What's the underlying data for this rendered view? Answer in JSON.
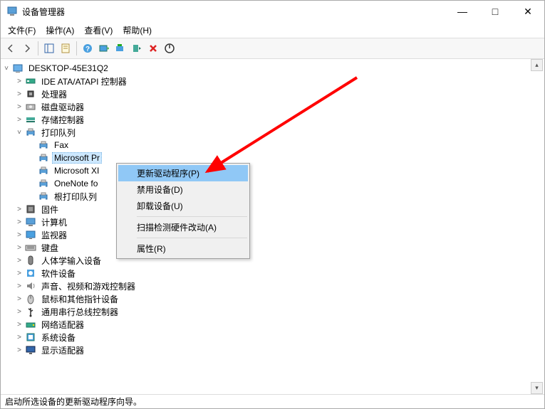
{
  "window": {
    "title": "设备管理器"
  },
  "winControls": {
    "min": "—",
    "max": "□",
    "close": "✕"
  },
  "menu": {
    "file": "文件(F)",
    "action": "操作(A)",
    "view": "查看(V)",
    "help": "帮助(H)"
  },
  "tree": {
    "root": "DESKTOP-45E31Q2",
    "items": [
      {
        "label": "IDE ATA/ATAPI 控制器",
        "icon": "ide",
        "expanded": false
      },
      {
        "label": "处理器",
        "icon": "cpu",
        "expanded": false
      },
      {
        "label": "磁盘驱动器",
        "icon": "disk",
        "expanded": false
      },
      {
        "label": "存储控制器",
        "icon": "storage",
        "expanded": false
      },
      {
        "label": "打印队列",
        "icon": "printer",
        "expanded": true,
        "children": [
          {
            "label": "Fax",
            "icon": "printer"
          },
          {
            "label": "Microsoft Pr",
            "icon": "printer",
            "selected": true
          },
          {
            "label": "Microsoft XI",
            "icon": "printer"
          },
          {
            "label": "OneNote fo",
            "icon": "printer"
          },
          {
            "label": "根打印队列",
            "icon": "printer"
          }
        ]
      },
      {
        "label": "固件",
        "icon": "firmware",
        "expanded": false
      },
      {
        "label": "计算机",
        "icon": "computer",
        "expanded": false
      },
      {
        "label": "监视器",
        "icon": "monitor",
        "expanded": false
      },
      {
        "label": "键盘",
        "icon": "keyboard",
        "expanded": false
      },
      {
        "label": "人体学输入设备",
        "icon": "hid",
        "expanded": false
      },
      {
        "label": "软件设备",
        "icon": "software",
        "expanded": false
      },
      {
        "label": "声音、视频和游戏控制器",
        "icon": "sound",
        "expanded": false
      },
      {
        "label": "鼠标和其他指针设备",
        "icon": "mouse",
        "expanded": false
      },
      {
        "label": "通用串行总线控制器",
        "icon": "usb",
        "expanded": false
      },
      {
        "label": "网络适配器",
        "icon": "network",
        "expanded": false
      },
      {
        "label": "系统设备",
        "icon": "system",
        "expanded": false
      },
      {
        "label": "显示适配器",
        "icon": "display",
        "expanded": false
      }
    ]
  },
  "contextMenu": {
    "items": [
      {
        "label": "更新驱动程序(P)",
        "highlight": true
      },
      {
        "label": "禁用设备(D)"
      },
      {
        "label": "卸载设备(U)"
      },
      {
        "sep": true
      },
      {
        "label": "扫描检测硬件改动(A)"
      },
      {
        "sep": true
      },
      {
        "label": "属性(R)"
      }
    ]
  },
  "status": "启动所选设备的更新驱动程序向导。"
}
